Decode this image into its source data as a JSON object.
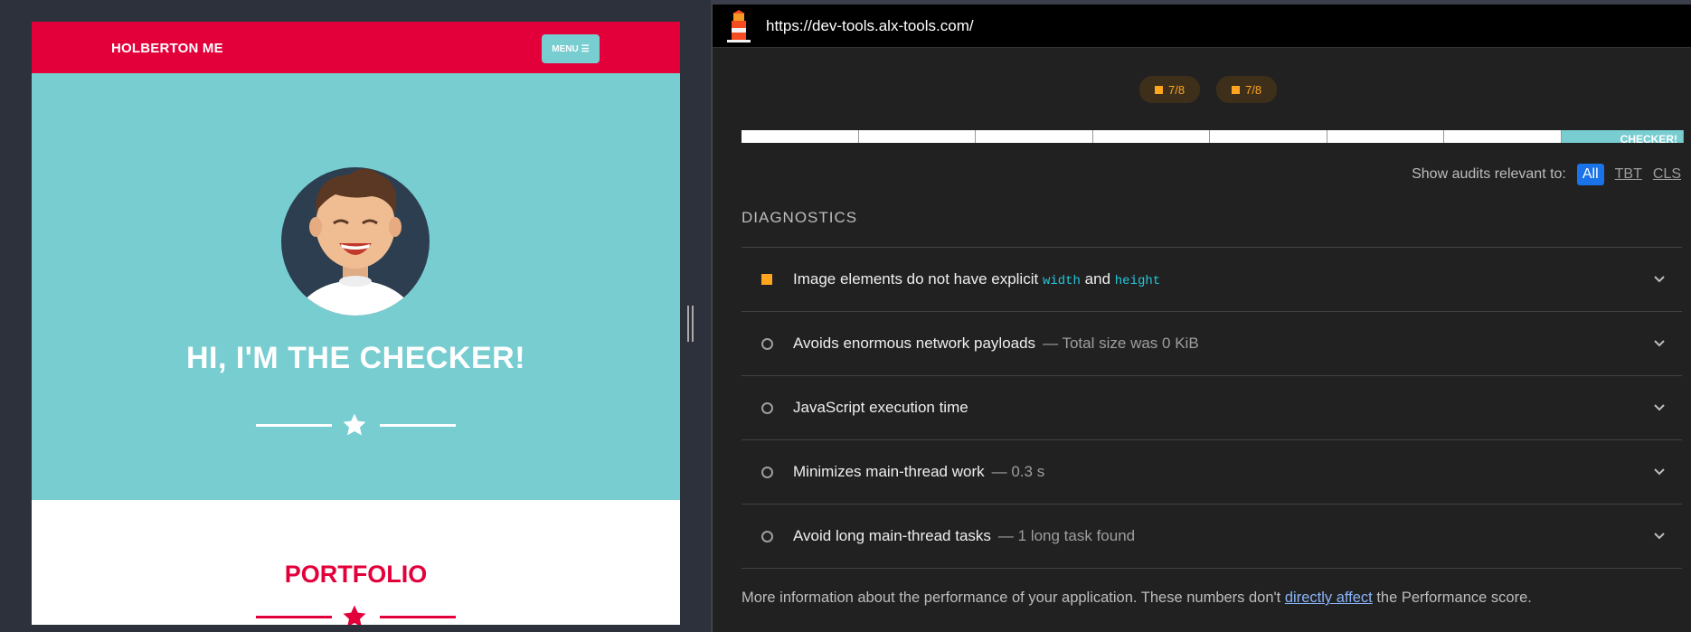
{
  "site": {
    "brand": "HOLBERTON ME",
    "menu_label": "MENU",
    "hero_title": "HI, I'M THE CHECKER!",
    "portfolio_title": "PORTFOLIO",
    "colors": {
      "primary": "#e3003a",
      "accent": "#78cdd1"
    }
  },
  "lighthouse": {
    "url": "https://dev-tools.alx-tools.com/",
    "badges": [
      "7/8",
      "7/8"
    ],
    "filmstrip_last_text": "CHECKER!",
    "filter": {
      "label": "Show audits relevant to:",
      "options": [
        "All",
        "TBT",
        "CLS"
      ],
      "selected": "All"
    },
    "diagnostics_title": "DIAGNOSTICS",
    "audits": [
      {
        "title_pre": "Image elements do not have explicit ",
        "code1": "width",
        "mid": " and ",
        "code2": "height",
        "status": "fail"
      },
      {
        "title": "Avoids enormous network payloads",
        "detail": "— Total size was 0 KiB",
        "status": "pass"
      },
      {
        "title": "JavaScript execution time",
        "detail": "",
        "status": "pass"
      },
      {
        "title": "Minimizes main-thread work",
        "detail": "— 0.3 s",
        "status": "pass"
      },
      {
        "title": "Avoid long main-thread tasks",
        "detail": "— 1 long task found",
        "status": "pass"
      }
    ],
    "footnote": {
      "pre": "More information about the performance of your application. These numbers don't ",
      "link": "directly affect",
      "post": " the Performance score."
    },
    "icons": {
      "logo": "lighthouse-icon",
      "chevron": "chevron-down-icon",
      "fail": "warning-square-icon",
      "pass": "info-circle-icon"
    }
  }
}
